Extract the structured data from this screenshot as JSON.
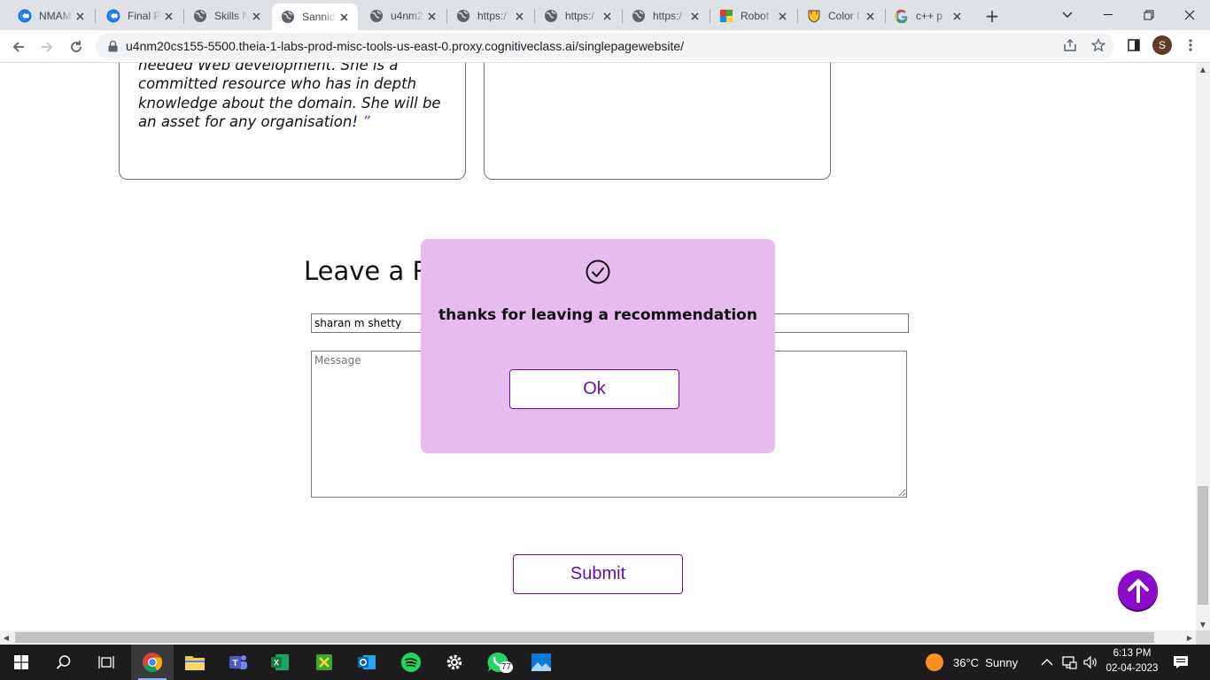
{
  "browser": {
    "tabs": [
      {
        "title": "NMAM",
        "icon": "chrome-icon"
      },
      {
        "title": "Final P",
        "icon": "chrome-icon"
      },
      {
        "title": "Skills N",
        "icon": "globe-icon"
      },
      {
        "title": "Sannid",
        "icon": "globe-icon",
        "active": true
      },
      {
        "title": "u4nm2",
        "icon": "globe-icon"
      },
      {
        "title": "https:/",
        "icon": "globe-icon"
      },
      {
        "title": "https:/",
        "icon": "globe-icon"
      },
      {
        "title": "https:/",
        "icon": "globe-icon"
      },
      {
        "title": "Robot",
        "icon": "robot-icon"
      },
      {
        "title": "Color I",
        "icon": "shield-icon"
      },
      {
        "title": "c++ p",
        "icon": "google-icon"
      }
    ],
    "url": "u4nm20cs155-5500.theia-1-labs-prod-misc-tools-us-east-0.proxy.cognitiveclass.ai/singlepagewebsite/",
    "profile_initial": "S"
  },
  "page": {
    "recommendation_quote": "the initial phase of our venture which needed Web development. She is a committed resource who has in depth knowledge about the domain. She will be an asset for any organisation!",
    "closing_quote_mark": "”",
    "section_title": "Leave a Recommendation",
    "name_value": "sharan m shetty",
    "message_placeholder": "Message",
    "submit_label": "Submit"
  },
  "modal": {
    "message": "thanks for leaving a recommendation",
    "ok_label": "Ok"
  },
  "taskbar": {
    "weather": "36°C  Sunny",
    "time": "6:13 PM",
    "date": "02-04-2023",
    "whatsapp_badge": "77"
  },
  "colors": {
    "accent": "#6a0dad",
    "modal_bg": "#e7bbef",
    "scroll_top_bg": "#8a0cc9"
  }
}
